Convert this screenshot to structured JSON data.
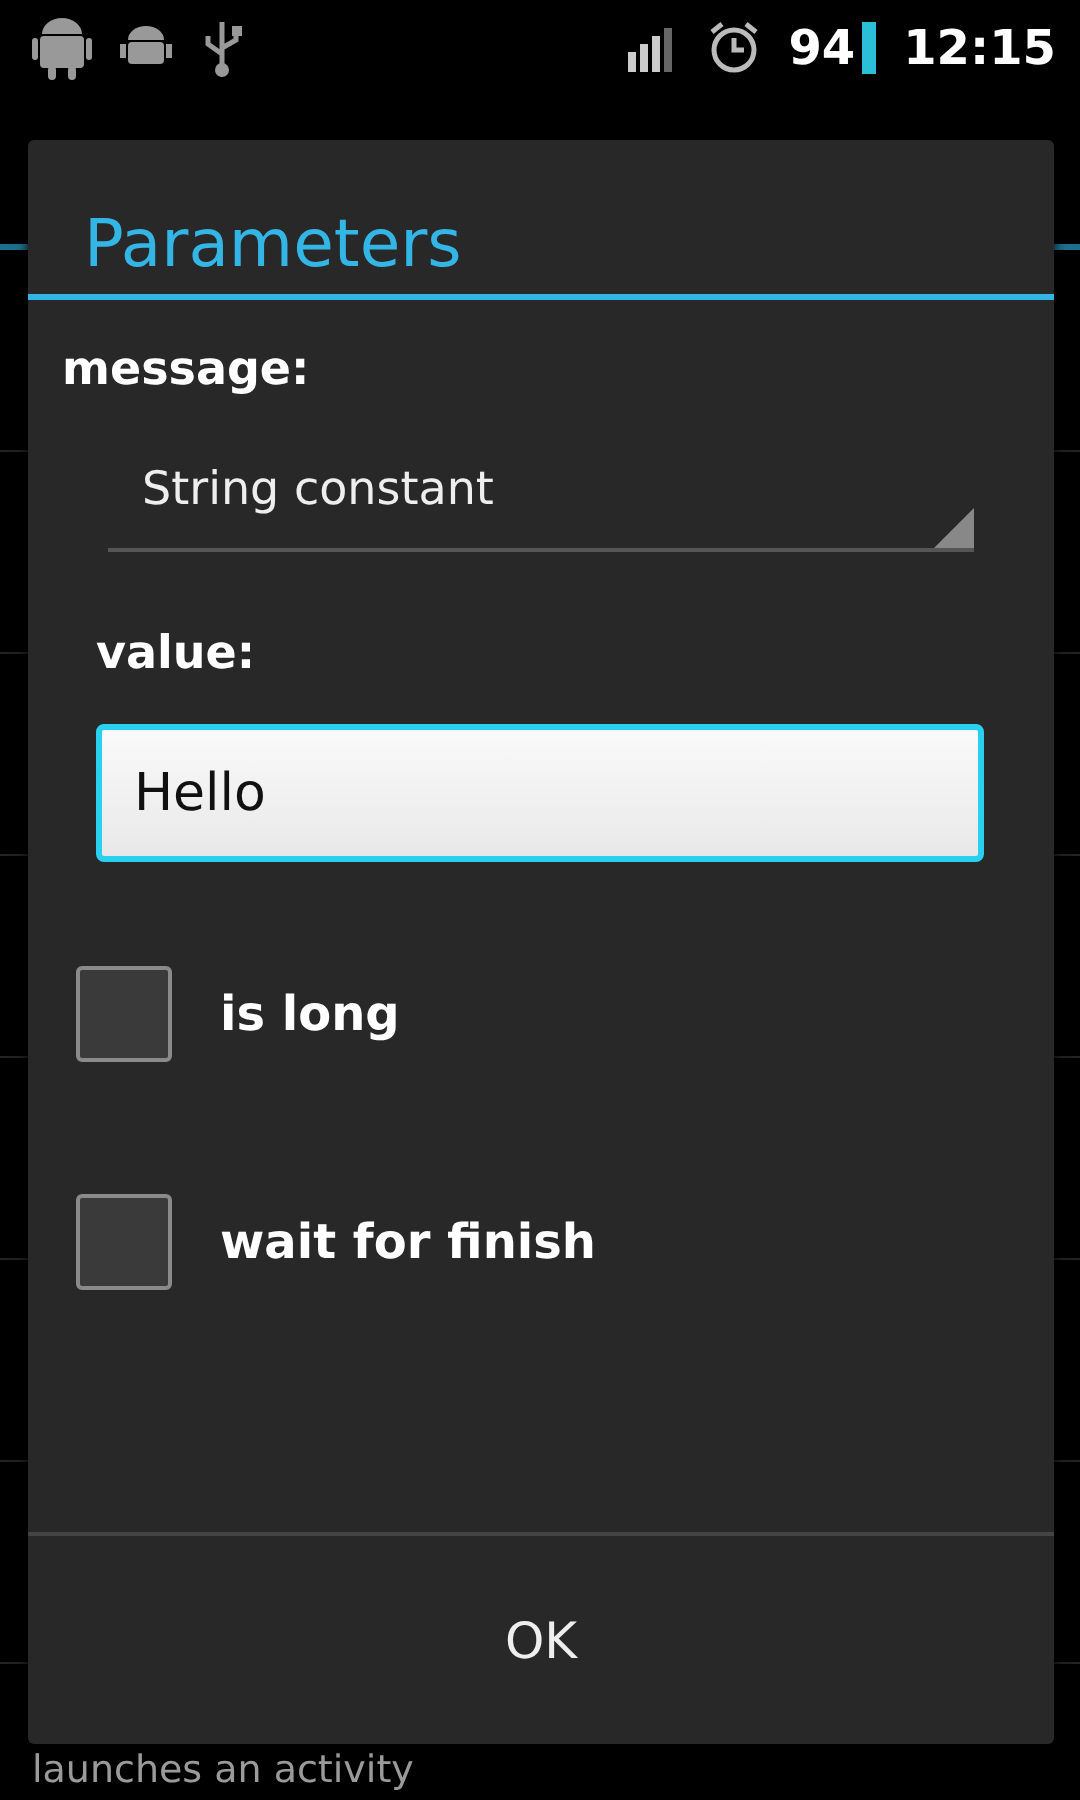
{
  "status_bar": {
    "battery": "94",
    "time": "12:15"
  },
  "background": {
    "subtitle": "launches an activity"
  },
  "dialog": {
    "title": "Parameters",
    "message_label": "message:",
    "source": {
      "value": "String constant"
    },
    "value_label": "value:",
    "value_input": {
      "value": "Hello"
    },
    "checkboxes": [
      {
        "label": "is long",
        "checked": false
      },
      {
        "label": "wait for finish",
        "checked": false
      }
    ],
    "button": "OK"
  }
}
